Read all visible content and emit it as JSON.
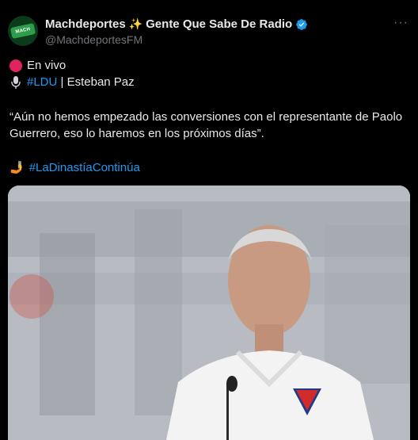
{
  "author": {
    "name": "Machdeportes",
    "name_suffix": "Gente Que Sabe De Radio",
    "handle": "@MachdeportesFM",
    "avatar_text": "MACH"
  },
  "tweet": {
    "live_label": "En vivo",
    "tag_ldu": "#LDU",
    "speaker": "| Esteban Paz",
    "quote": "“Aún no hemos empezado las conversiones con el representante de Paolo Guerrero, eso lo haremos en los próximos días”.",
    "hashtag": "#LaDinastíaContinúa"
  },
  "colors": {
    "link": "#1d9bf0",
    "verified": "#1d9bf0",
    "live_dot": "#e0245e"
  },
  "icons": [
    "sparkles-icon",
    "verified-badge-icon",
    "more-icon",
    "red-circle-icon",
    "microphone-icon",
    "hand-icon"
  ]
}
